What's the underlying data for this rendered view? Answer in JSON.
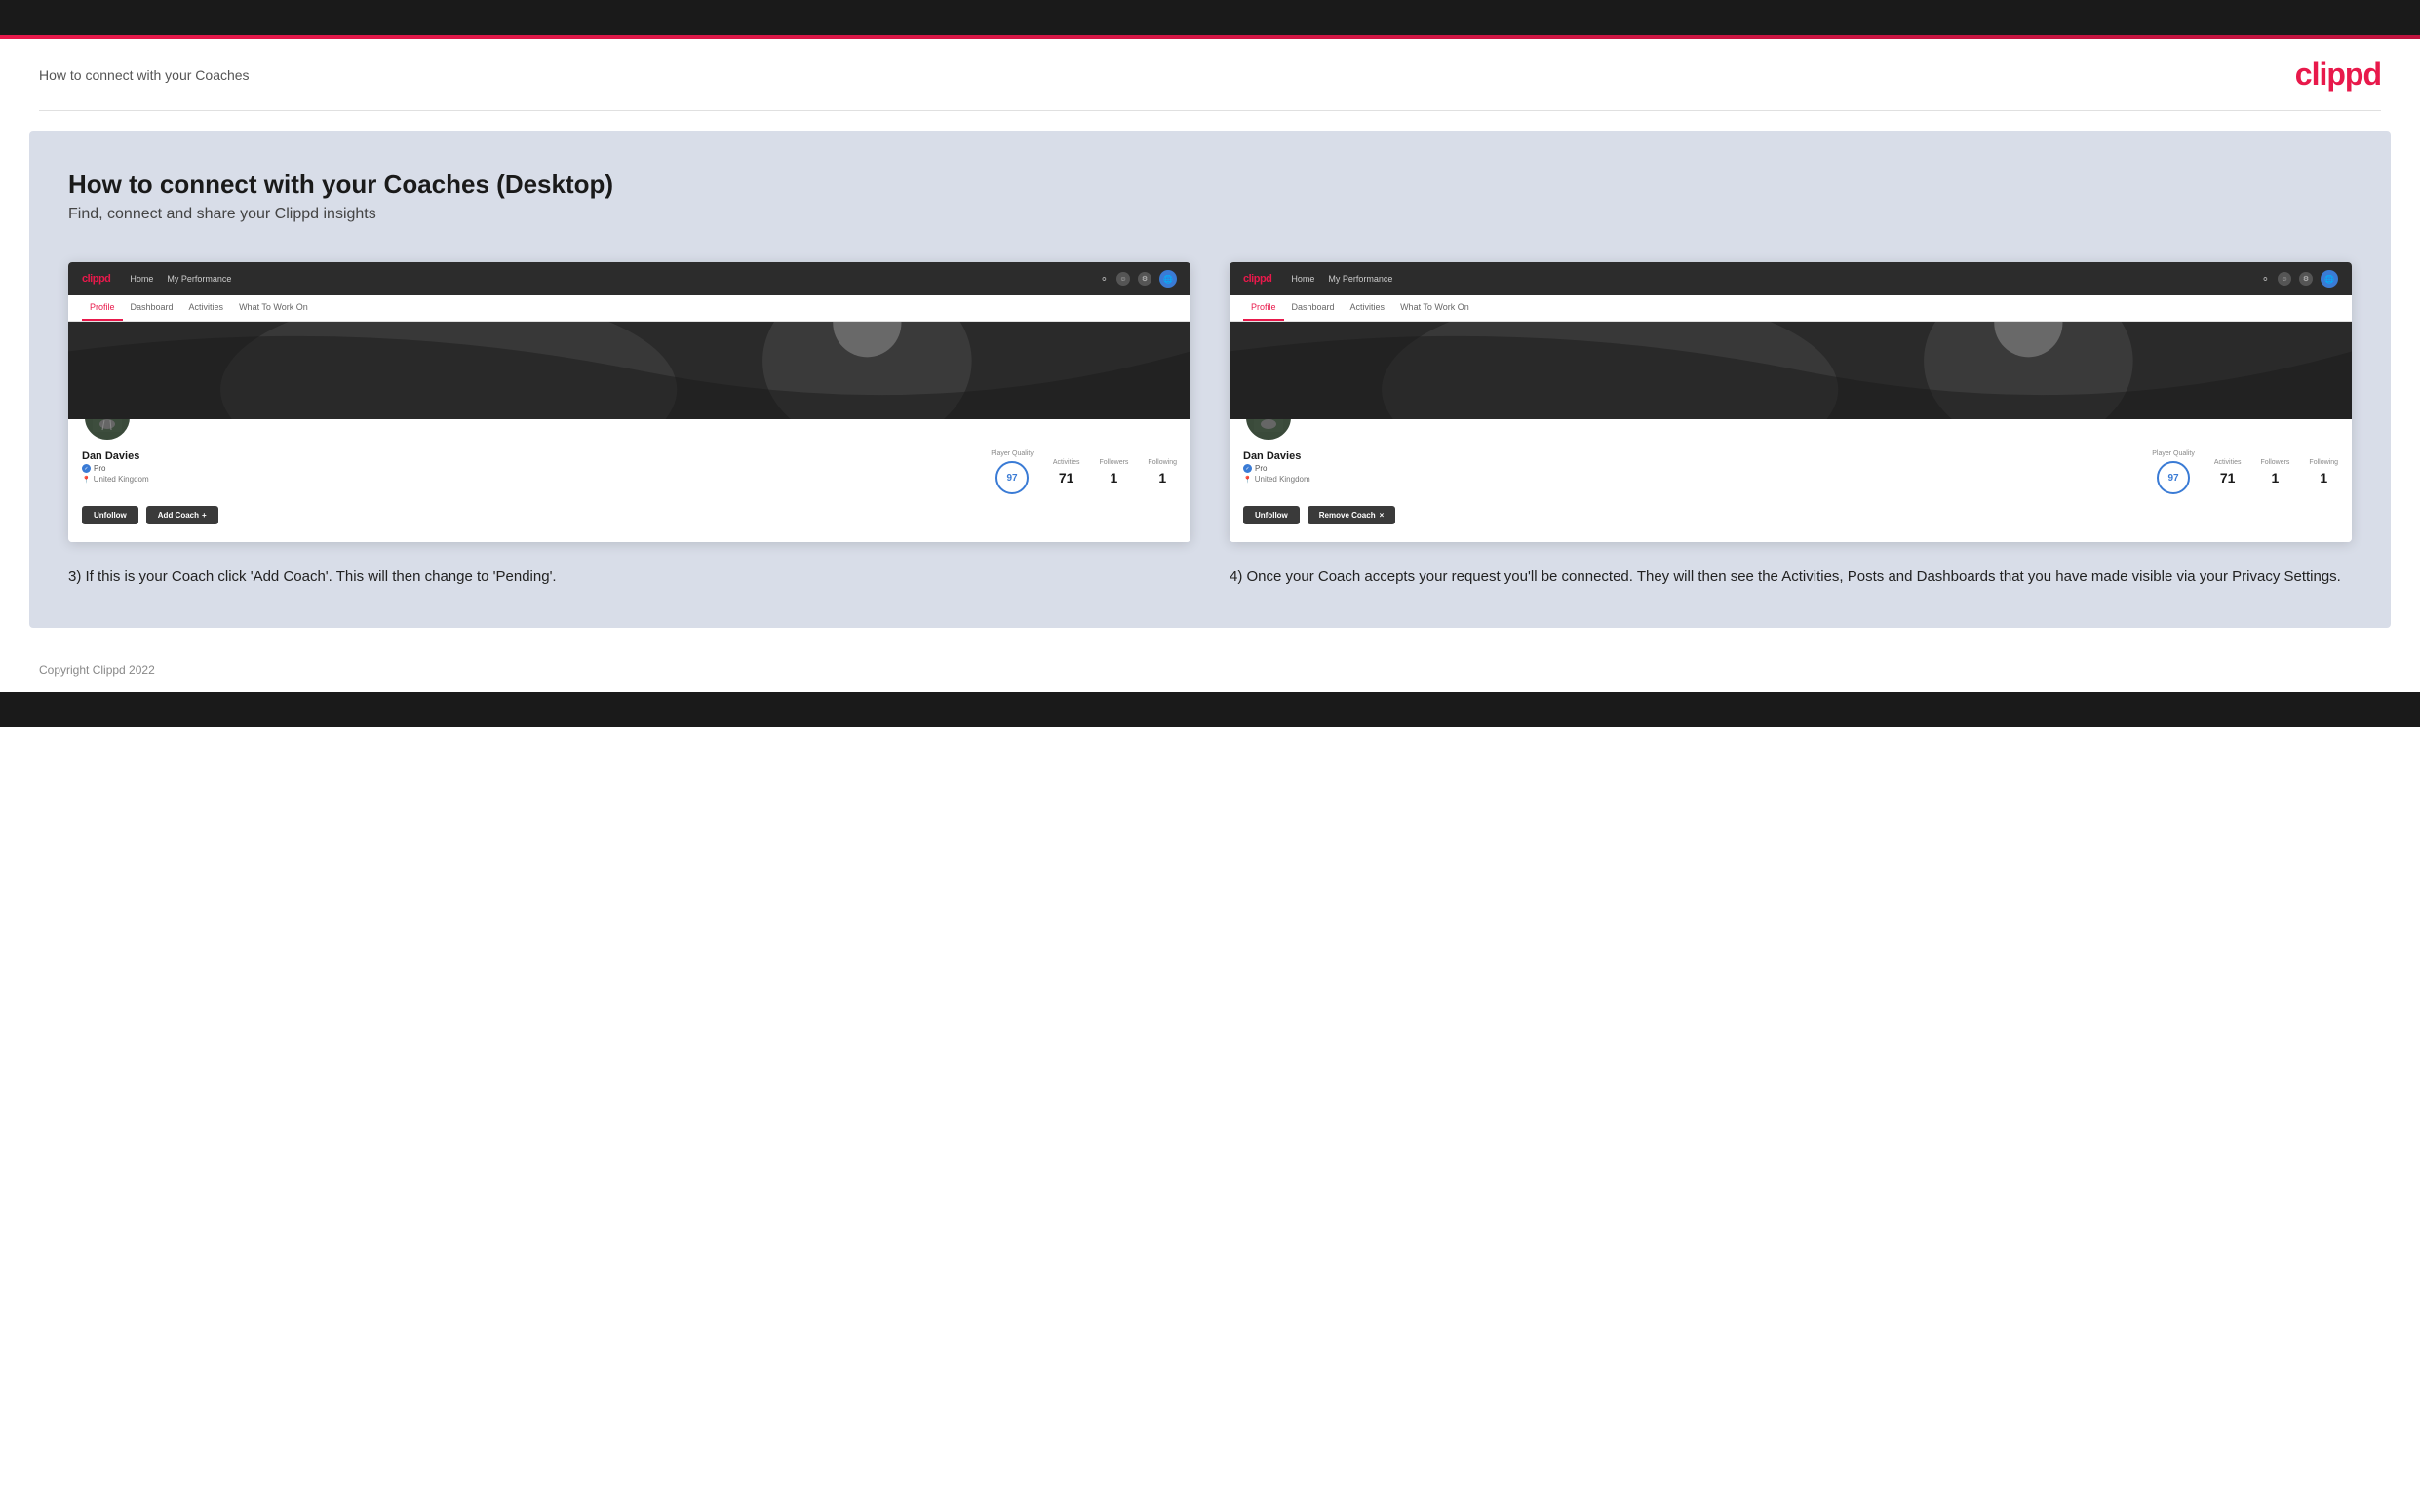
{
  "topBar": {},
  "header": {
    "title": "How to connect with your Coaches",
    "logo": "clippd"
  },
  "mainContent": {
    "heading": "How to connect with your Coaches (Desktop)",
    "subheading": "Find, connect and share your Clippd insights",
    "columns": [
      {
        "id": "left",
        "mockNav": {
          "logo": "clippd",
          "links": [
            "Home",
            "My Performance"
          ],
          "icons": [
            "search",
            "user",
            "settings",
            "globe"
          ]
        },
        "mockTabs": [
          "Profile",
          "Dashboard",
          "Activities",
          "What To Work On"
        ],
        "activeTab": "Profile",
        "player": {
          "name": "Dan Davies",
          "role": "Pro",
          "location": "United Kingdom",
          "playerQuality": 97,
          "activities": 71,
          "followers": 1,
          "following": 1
        },
        "buttons": [
          {
            "label": "Unfollow",
            "type": "dark"
          },
          {
            "label": "Add Coach",
            "type": "outline",
            "icon": "+"
          }
        ],
        "stepLabel": "3) If this is your Coach click 'Add Coach'. This will then change to 'Pending'."
      },
      {
        "id": "right",
        "mockNav": {
          "logo": "clippd",
          "links": [
            "Home",
            "My Performance"
          ],
          "icons": [
            "search",
            "user",
            "settings",
            "globe"
          ]
        },
        "mockTabs": [
          "Profile",
          "Dashboard",
          "Activities",
          "What To Work On"
        ],
        "activeTab": "Profile",
        "player": {
          "name": "Dan Davies",
          "role": "Pro",
          "location": "United Kingdom",
          "playerQuality": 97,
          "activities": 71,
          "followers": 1,
          "following": 1
        },
        "buttons": [
          {
            "label": "Unfollow",
            "type": "dark"
          },
          {
            "label": "Remove Coach",
            "type": "remove",
            "icon": "×"
          }
        ],
        "stepLabel": "4) Once your Coach accepts your request you'll be connected. They will then see the Activities, Posts and Dashboards that you have made visible via your Privacy Settings."
      }
    ]
  },
  "footer": {
    "copyright": "Copyright Clippd 2022"
  },
  "stats": {
    "playerQualityLabel": "Player Quality",
    "activitiesLabel": "Activities",
    "followersLabel": "Followers",
    "followingLabel": "Following"
  }
}
